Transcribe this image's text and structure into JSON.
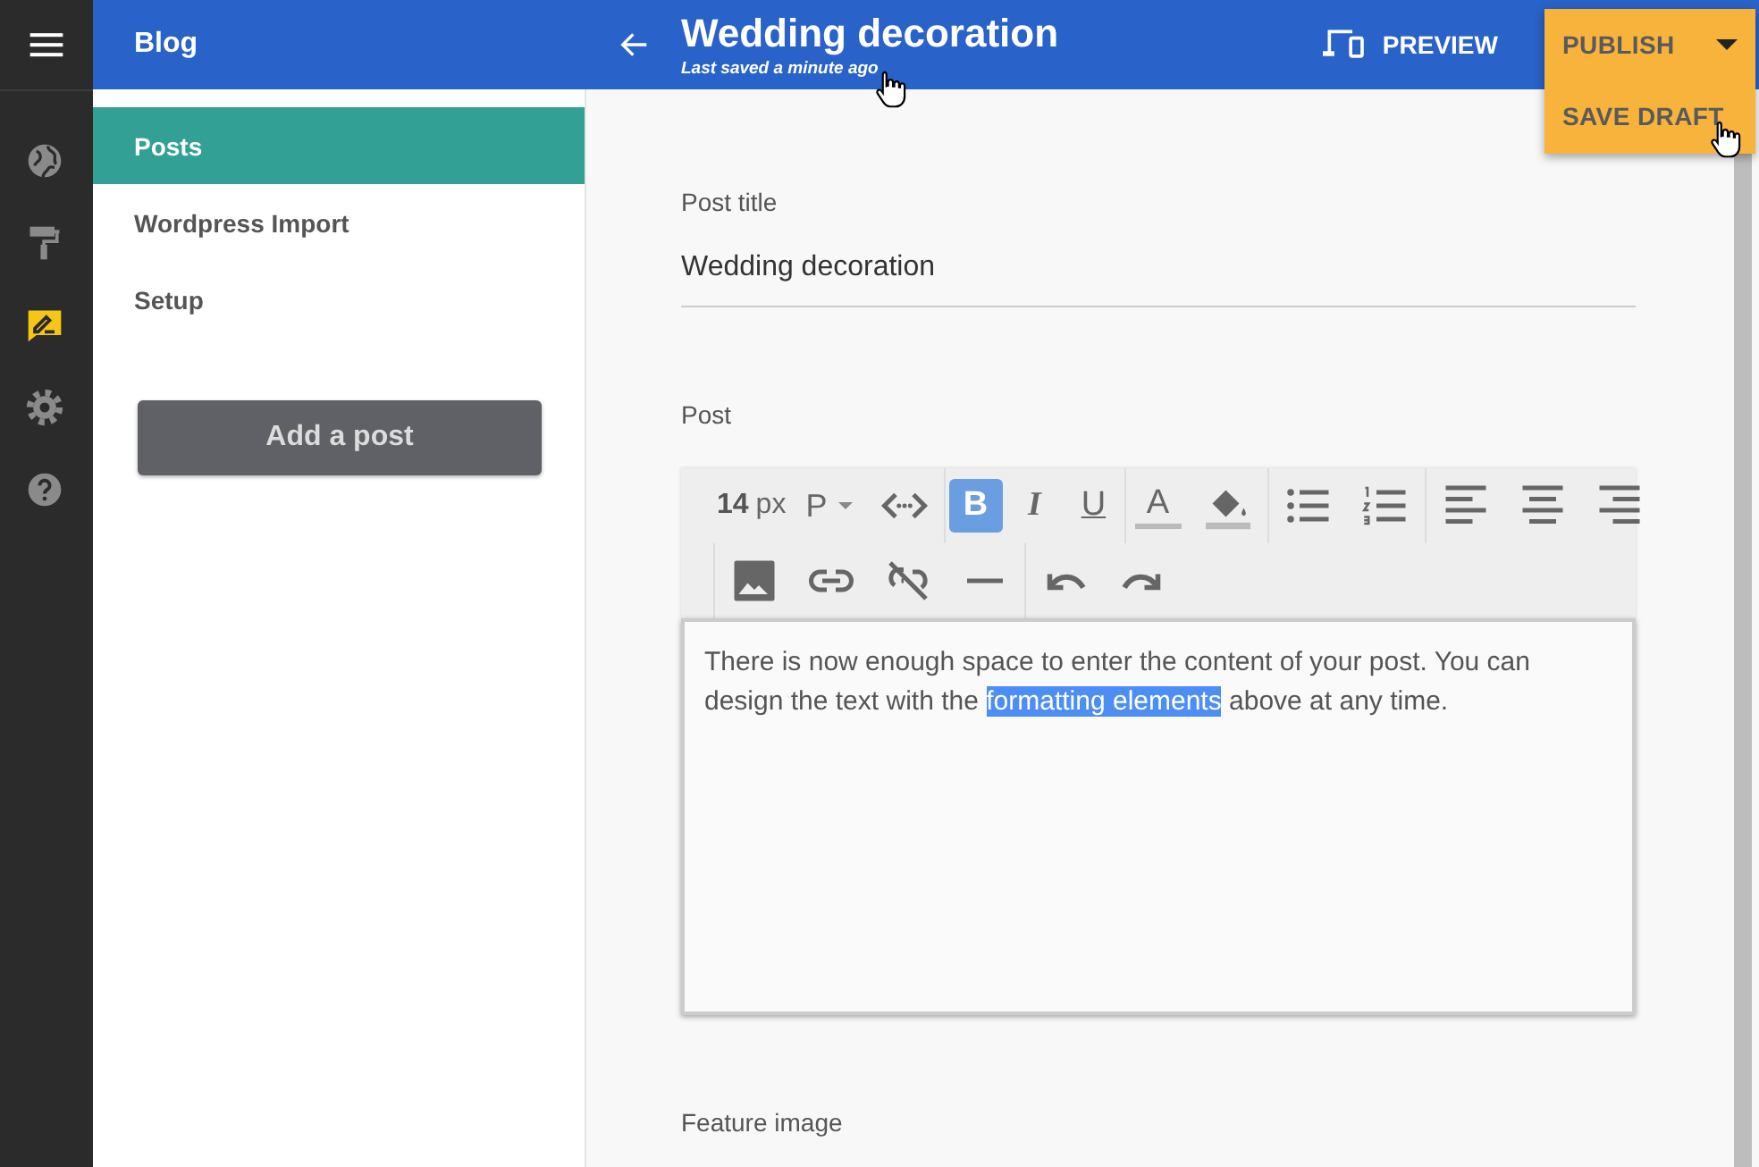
{
  "rail": {
    "items": [
      {
        "kind": "globe",
        "selected": false
      },
      {
        "kind": "roller",
        "selected": false
      },
      {
        "kind": "blog",
        "selected": true
      },
      {
        "kind": "gear",
        "selected": false
      },
      {
        "kind": "help",
        "selected": false
      }
    ]
  },
  "sidebar": {
    "title": "Blog",
    "items": [
      {
        "label": "Posts",
        "selected": true
      },
      {
        "label": "Wordpress Import",
        "selected": false
      },
      {
        "label": "Setup",
        "selected": false
      }
    ],
    "button": "Add a post"
  },
  "header": {
    "title": "Wedding decoration",
    "subtitle": "Last saved a minute ago",
    "preview": "PREVIEW",
    "publish_menu": {
      "expanded": true,
      "items": [
        {
          "label": "PUBLISH"
        },
        {
          "label": "SAVE DRAFT"
        }
      ]
    }
  },
  "form": {
    "post_title_label": "Post title",
    "post_title_value": "Wedding decoration",
    "post_label": "Post",
    "toolbar": {
      "font_size": "14",
      "font_unit": "px",
      "block": "P",
      "rows": [
        [
          [
            {
              "kind": "code"
            }
          ],
          [
            {
              "kind": "bold",
              "glyph": "B",
              "active": true
            },
            {
              "kind": "italic",
              "glyph": "I",
              "active": false
            },
            {
              "kind": "underline",
              "glyph": "U",
              "active": false
            }
          ],
          [
            {
              "kind": "text-color",
              "glyph": "A",
              "active": false
            },
            {
              "kind": "fill-color",
              "active": false
            }
          ],
          [
            {
              "kind": "bullet-list",
              "active": false
            },
            {
              "kind": "numbered-list",
              "active": false
            }
          ],
          [
            {
              "kind": "align-left",
              "active": false
            },
            {
              "kind": "align-center",
              "active": false
            },
            {
              "kind": "align-right",
              "active": false
            }
          ]
        ],
        [
          [
            {
              "kind": "image",
              "active": false
            },
            {
              "kind": "link",
              "active": false
            },
            {
              "kind": "unlink",
              "active": false
            },
            {
              "kind": "rule",
              "active": false
            }
          ],
          [
            {
              "kind": "undo",
              "active": false
            },
            {
              "kind": "redo",
              "active": false
            }
          ]
        ]
      ]
    },
    "content": [
      {
        "text": "There is now enough space to enter the content of your post. You can design the text with the ",
        "selected": false
      },
      {
        "text": "formatting elements",
        "selected": true
      },
      {
        "text": " above at any time.",
        "selected": false
      }
    ],
    "feature_image_label": "Feature image"
  }
}
